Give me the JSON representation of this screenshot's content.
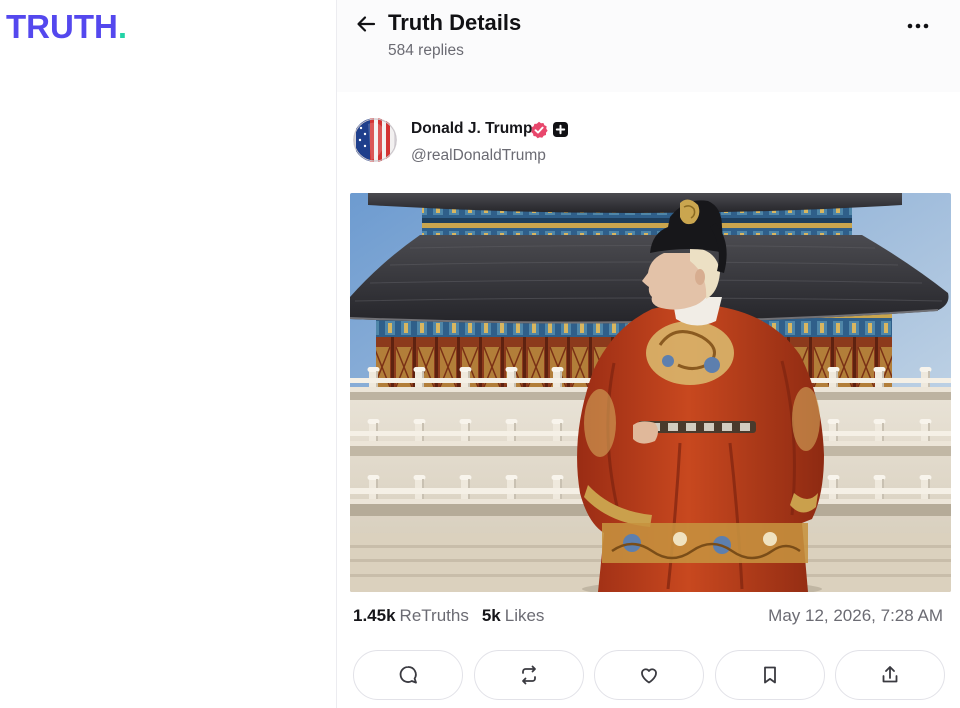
{
  "colors": {
    "brand": "#5448ee",
    "brand_dot": "#22d3a6",
    "verified": "#e8476c",
    "muted_text": "#6b6b73"
  },
  "brand": {
    "logo_text": "TRUTH",
    "logo_dot": "."
  },
  "header": {
    "back_icon": "back-arrow-icon",
    "title": "Truth Details",
    "subtitle": "584 replies",
    "more_icon": "more-options-icon"
  },
  "post": {
    "author": {
      "name": "Donald J. Trump",
      "handle": "@realDonaldTrump",
      "verified_icon": "verified-badge-icon",
      "truth_plus_icon": "truth-plus-badge-icon"
    },
    "stats": {
      "retruths_count": "1.45k",
      "retruths_label": "ReTruths",
      "likes_count": "5k",
      "likes_label": "Likes"
    },
    "timestamp": "May 12, 2026, 7:28 AM",
    "action_icons": [
      "reply-icon",
      "retruth-icon",
      "heart-icon",
      "bookmark-icon",
      "share-icon"
    ]
  }
}
